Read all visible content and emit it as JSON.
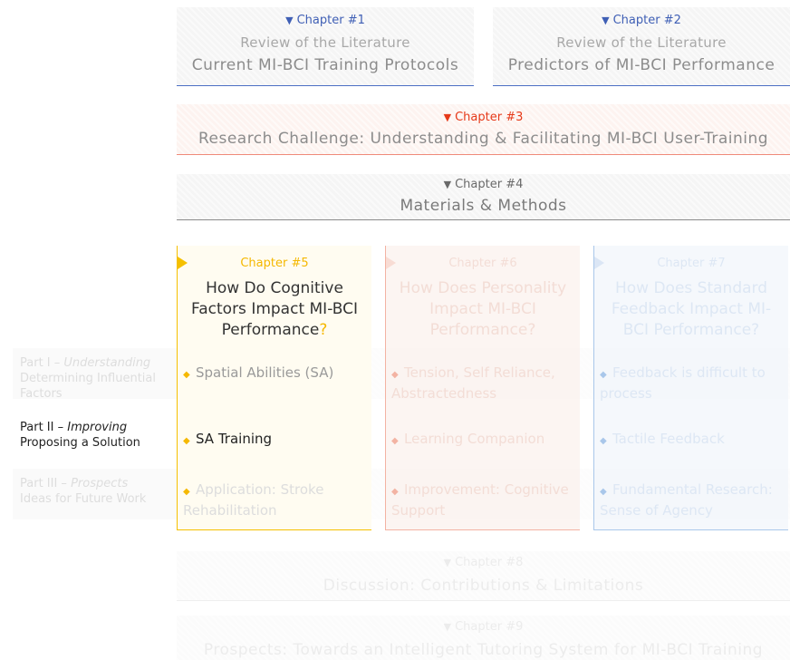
{
  "chapters": {
    "c1": {
      "label": "Chapter #1",
      "sub": "Review of the Literature",
      "title": "Current MI-BCI Training Protocols"
    },
    "c2": {
      "label": "Chapter #2",
      "sub": "Review of the Literature",
      "title": "Predictors of MI-BCI Performance"
    },
    "c3": {
      "label": "Chapter #3",
      "title": "Research Challenge: Understanding & Facilitating MI-BCI User-Training"
    },
    "c4": {
      "label": "Chapter #4",
      "title": "Materials & Methods"
    },
    "c5": {
      "label": "Chapter #5",
      "title": "How Do Cognitive Factors Impact MI-BCI Performance",
      "qmark": "?",
      "items": [
        "Spatial Abilities (SA)",
        "SA Training",
        "Application: Stroke Rehabilitation"
      ]
    },
    "c6": {
      "label": "Chapter #6",
      "title": "How Does Personality Impact MI-BCI Performance?",
      "items": [
        "Tension, Self Reliance, Abstractedness",
        "Learning Companion",
        "Improvement: Cognitive Support"
      ]
    },
    "c7": {
      "label": "Chapter #7",
      "title": "How Does Standard Feedback Impact MI-BCI Performance?",
      "items": [
        "Feedback is difficult to process",
        "Tactile Feedback",
        "Fundamental Research: Sense of Agency"
      ]
    },
    "c8": {
      "label": "Chapter #8",
      "title": "Discussion: Contributions & Limitations"
    },
    "c9": {
      "label": "Chapter #9",
      "title": "Prospects: Towards an Intelligent Tutoring System for MI-BCI Training"
    }
  },
  "parts": [
    {
      "prefix": "Part I – ",
      "em": "Understanding",
      "line2": "Determining Influential Factors"
    },
    {
      "prefix": "Part II – ",
      "em": "Improving",
      "line2": "Proposing a Solution"
    },
    {
      "prefix": "Part III – ",
      "em": "Prospects",
      "line2": "Ideas for Future Work"
    }
  ],
  "colors": {
    "blue": "#3f5fb5",
    "red": "#e63a1a",
    "orange": "#f5b800",
    "peach": "#f3b3a3",
    "lightblue": "#a9c7ea"
  }
}
